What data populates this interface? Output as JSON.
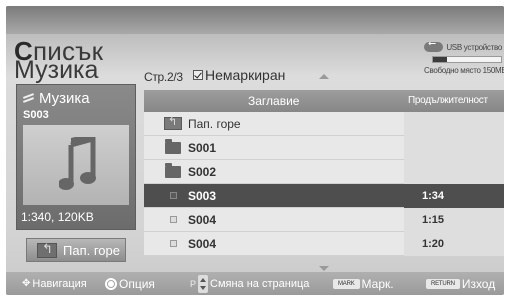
{
  "header": {
    "title_cap": "С",
    "title_rest": "писък",
    "subtitle": "Музика",
    "page_indicator": "Стр.2/3",
    "filter_label": "Немаркиран"
  },
  "usb": {
    "device_label": "USB устройство",
    "free_space_label": "Свободно място 150MB",
    "used_fraction": 0.2
  },
  "info_panel": {
    "category": "Музика",
    "track": "S003",
    "meta": "1:340, 120KB"
  },
  "up_button": {
    "label": "Пап. горе"
  },
  "list": {
    "col_title": "Заглавие",
    "col_duration": "Продължителност",
    "rows": [
      {
        "type": "up",
        "name": "Пап. горе",
        "duration": ""
      },
      {
        "type": "folder",
        "name": "S001",
        "duration": ""
      },
      {
        "type": "folder",
        "name": "S002",
        "duration": ""
      },
      {
        "type": "file",
        "name": "S003",
        "duration": "1:34",
        "selected": true
      },
      {
        "type": "file",
        "name": "S004",
        "duration": "1:15"
      },
      {
        "type": "file",
        "name": "S004",
        "duration": "1:20"
      }
    ]
  },
  "footer": {
    "navigation": "Навигация",
    "option": "Опция",
    "page_key": "P",
    "page_change": "Смяна на страница",
    "mark_key": "MARK",
    "mark": "Марк.",
    "return_key": "RETURN",
    "exit": "Изход"
  }
}
